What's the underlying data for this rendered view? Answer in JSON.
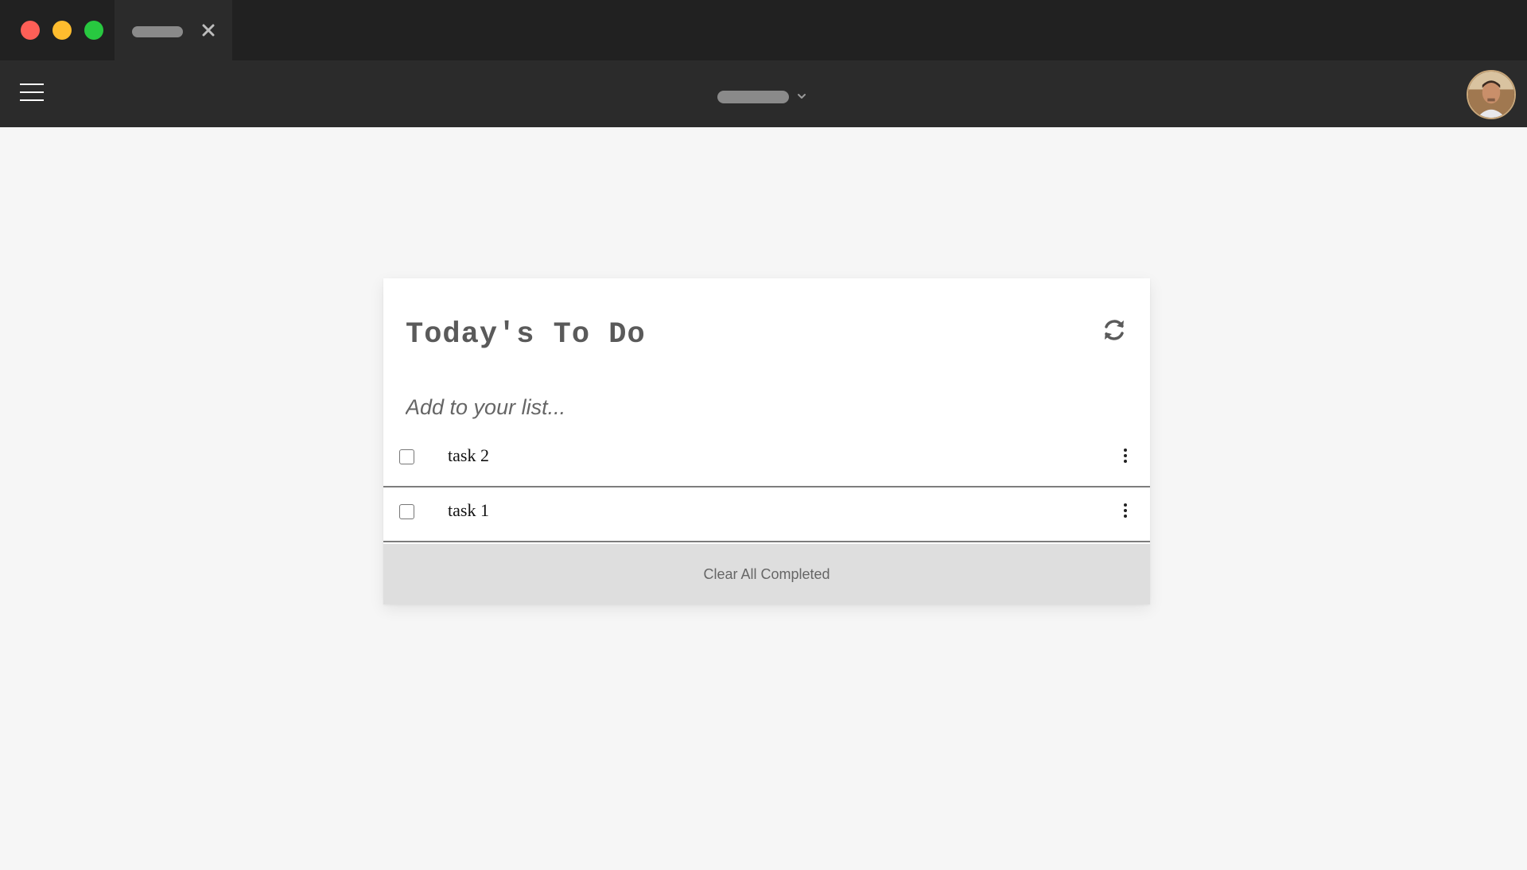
{
  "card": {
    "title": "Today's To Do",
    "input_placeholder": "Add to your list...",
    "tasks": [
      {
        "label": "task 2",
        "checked": false
      },
      {
        "label": "task 1",
        "checked": false
      }
    ],
    "clear_label": "Clear All Completed"
  },
  "icons": {
    "window_controls": [
      "close-light",
      "minimize-light",
      "maximize-light"
    ],
    "tab_close": "close-icon",
    "menu": "hamburger-menu-icon",
    "address_dropdown": "chevron-down-icon",
    "refresh": "refresh-icon",
    "task_menu": "more-vertical-icon"
  },
  "colors": {
    "titlebar": "#212121",
    "toolbar": "#2b2b2b",
    "page_bg": "#f6f6f6",
    "traffic_red": "#fe5f57",
    "traffic_yellow": "#febc2e",
    "traffic_green": "#28c840",
    "footer_bg": "#dedede"
  }
}
